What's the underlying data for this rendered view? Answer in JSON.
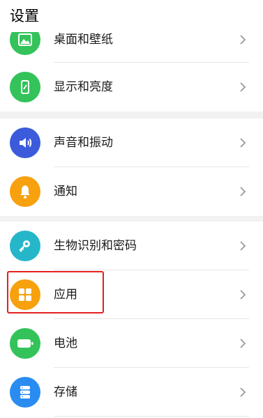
{
  "header": {
    "title": "设置"
  },
  "groups": [
    {
      "items": [
        {
          "label": "桌面和壁纸",
          "icon": "wallpaper-icon",
          "color": "#33c35a"
        },
        {
          "label": "显示和亮度",
          "icon": "display-icon",
          "color": "#33c35a"
        }
      ]
    },
    {
      "items": [
        {
          "label": "声音和振动",
          "icon": "volume-icon",
          "color": "#3b5bdb"
        },
        {
          "label": "通知",
          "icon": "bell-icon",
          "color": "#f7a10f"
        }
      ]
    },
    {
      "items": [
        {
          "label": "生物识别和密码",
          "icon": "key-icon",
          "color": "#25b7c9"
        },
        {
          "label": "应用",
          "icon": "apps-grid-icon",
          "color": "#f7a10f",
          "highlighted": true
        },
        {
          "label": "电池",
          "icon": "battery-icon",
          "color": "#33c35a"
        },
        {
          "label": "存储",
          "icon": "storage-icon",
          "color": "#2a8cf0"
        }
      ]
    }
  ],
  "colors": {
    "highlight_border": "#e51e1e",
    "divider": "#e6e6e6",
    "group_gap": "#f2f2f2",
    "chevron": "#9a9a9a"
  }
}
